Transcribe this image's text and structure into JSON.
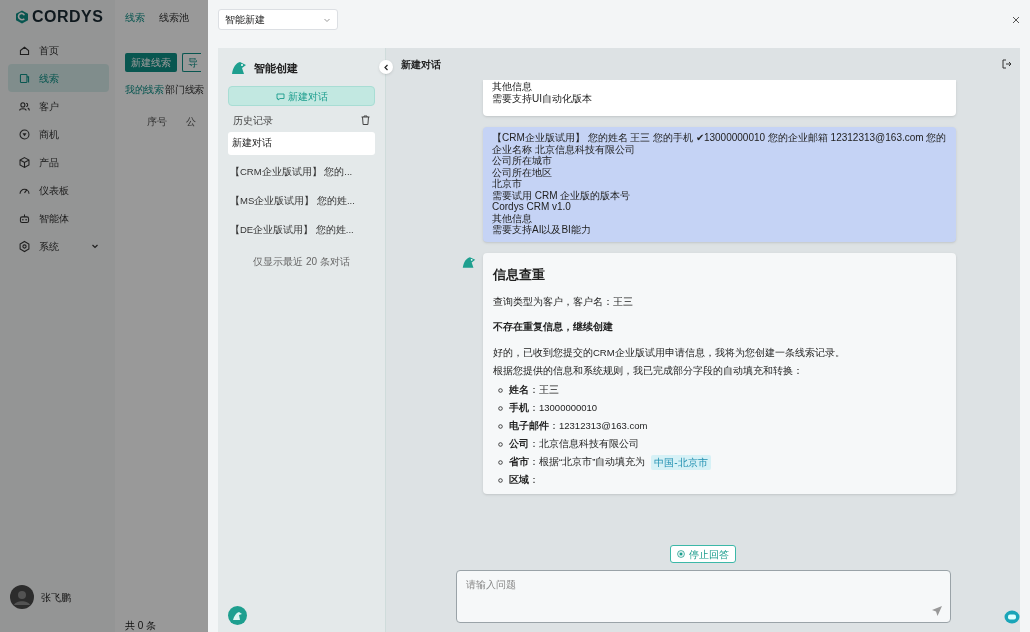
{
  "app": {
    "logo": "CORDYS",
    "top_tabs": [
      {
        "label": "线索",
        "selected": true
      },
      {
        "label": "线索池",
        "selected": false
      }
    ],
    "nav": [
      {
        "label": "首页",
        "selected": false,
        "expandable": false
      },
      {
        "label": "线索",
        "selected": true,
        "expandable": false
      },
      {
        "label": "客户",
        "selected": false,
        "expandable": false
      },
      {
        "label": "商机",
        "selected": false,
        "expandable": false
      },
      {
        "label": "产品",
        "selected": false,
        "expandable": false
      },
      {
        "label": "仪表板",
        "selected": false,
        "expandable": false
      },
      {
        "label": "智能体",
        "selected": false,
        "expandable": false
      },
      {
        "label": "系统",
        "selected": false,
        "expandable": true
      }
    ],
    "buttons": [
      {
        "label": "新建线索",
        "kind": "primary"
      },
      {
        "label": "导",
        "kind": "outline"
      }
    ],
    "list_tabs": [
      {
        "label": "我的线索",
        "selected": true
      },
      {
        "label": "部门线索",
        "selected": false
      }
    ],
    "table_columns": [
      "序号",
      "公"
    ],
    "user_name": "张飞鹏",
    "total": "共 0 条"
  },
  "drawer": {
    "mode_select": "智能新建",
    "panel_title": "智能创建",
    "new_chat": "新建对话",
    "history_label": "历史记录",
    "conversations": [
      {
        "title": "新建对话",
        "selected": true
      },
      {
        "title": "【CRM企业版试用】 您的...",
        "selected": false
      },
      {
        "title": "【MS企业版试用】 您的姓...",
        "selected": false
      },
      {
        "title": "【DE企业版试用】 您的姓...",
        "selected": false
      }
    ],
    "history_note": "仅显示最近 20 条对话",
    "chat_title": "新建对话",
    "messages": [
      {
        "kind": "note",
        "lines": [
          "其他信息",
          "需要支持UI自动化版本"
        ]
      },
      {
        "kind": "user",
        "lines": [
          "【CRM企业版试用】 您的姓名 王三 您的手机 ✔13000000010 您的企业邮箱 12312313@163.com 您的企业名称 北京信息科技有限公司",
          "公司所在城市",
          "公司所在地区",
          "北京市",
          "需要试用 CRM 企业版的版本号",
          "Cordys CRM v1.0",
          "其他信息",
          "需要支持AI以及BI能力"
        ]
      },
      {
        "kind": "reply",
        "blocks": [
          {
            "kind": "heading",
            "text": "信息查重"
          },
          {
            "kind": "paragraph",
            "text": "查询类型为客户，客户名：王三"
          },
          {
            "kind": "strong",
            "text": "不存在重复信息，继续创建"
          },
          {
            "kind": "paragraph",
            "text": "好的，已收到您提交的CRM企业版试用申请信息，我将为您创建一条线索记录。"
          },
          {
            "kind": "paragraph",
            "text": "根据您提供的信息和系统规则，我已完成部分字段的自动填充和转换："
          },
          {
            "kind": "list",
            "items": [
              {
                "label": "姓名",
                "value": "：王三"
              },
              {
                "label": "手机",
                "value": "：13000000010"
              },
              {
                "label": "电子邮件",
                "value": "：12312313@163.com"
              },
              {
                "label": "公司",
                "value": "：北京信息科技有限公司"
              },
              {
                "label": "省市",
                "value": "：根据“北京市”自动填充为",
                "tag": "中国-北京市"
              },
              {
                "label": "区域",
                "value": "："
              }
            ]
          }
        ]
      }
    ],
    "stop_button": "停止回答",
    "input_placeholder": "请输入问题"
  }
}
